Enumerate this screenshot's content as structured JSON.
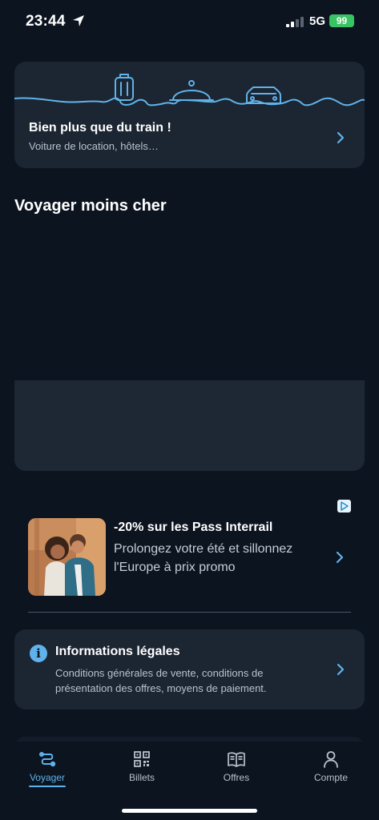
{
  "status_bar": {
    "time": "23:44",
    "network": "5G",
    "battery": "99"
  },
  "promo_card": {
    "title": "Bien plus que du train !",
    "subtitle": "Voiture de location, hôtels…"
  },
  "section_title": "Voyager moins cher",
  "ad": {
    "title": "-20% sur les Pass Interrail",
    "text": "Prolongez votre été et sillonnez l'Europe à prix promo"
  },
  "legal": {
    "title": "Informations légales",
    "text": "Conditions générales de vente, conditions de présentation des offres, moyens de paiement."
  },
  "tabs": [
    {
      "label": "Voyager",
      "icon": "route-icon",
      "active": true
    },
    {
      "label": "Billets",
      "icon": "qr-code-icon",
      "active": false
    },
    {
      "label": "Offres",
      "icon": "book-icon",
      "active": false
    },
    {
      "label": "Compte",
      "icon": "user-icon",
      "active": false
    }
  ],
  "colors": {
    "accent": "#5fb3ea",
    "background": "#0c1420",
    "card": "#1c2532",
    "battery": "#39c463"
  }
}
